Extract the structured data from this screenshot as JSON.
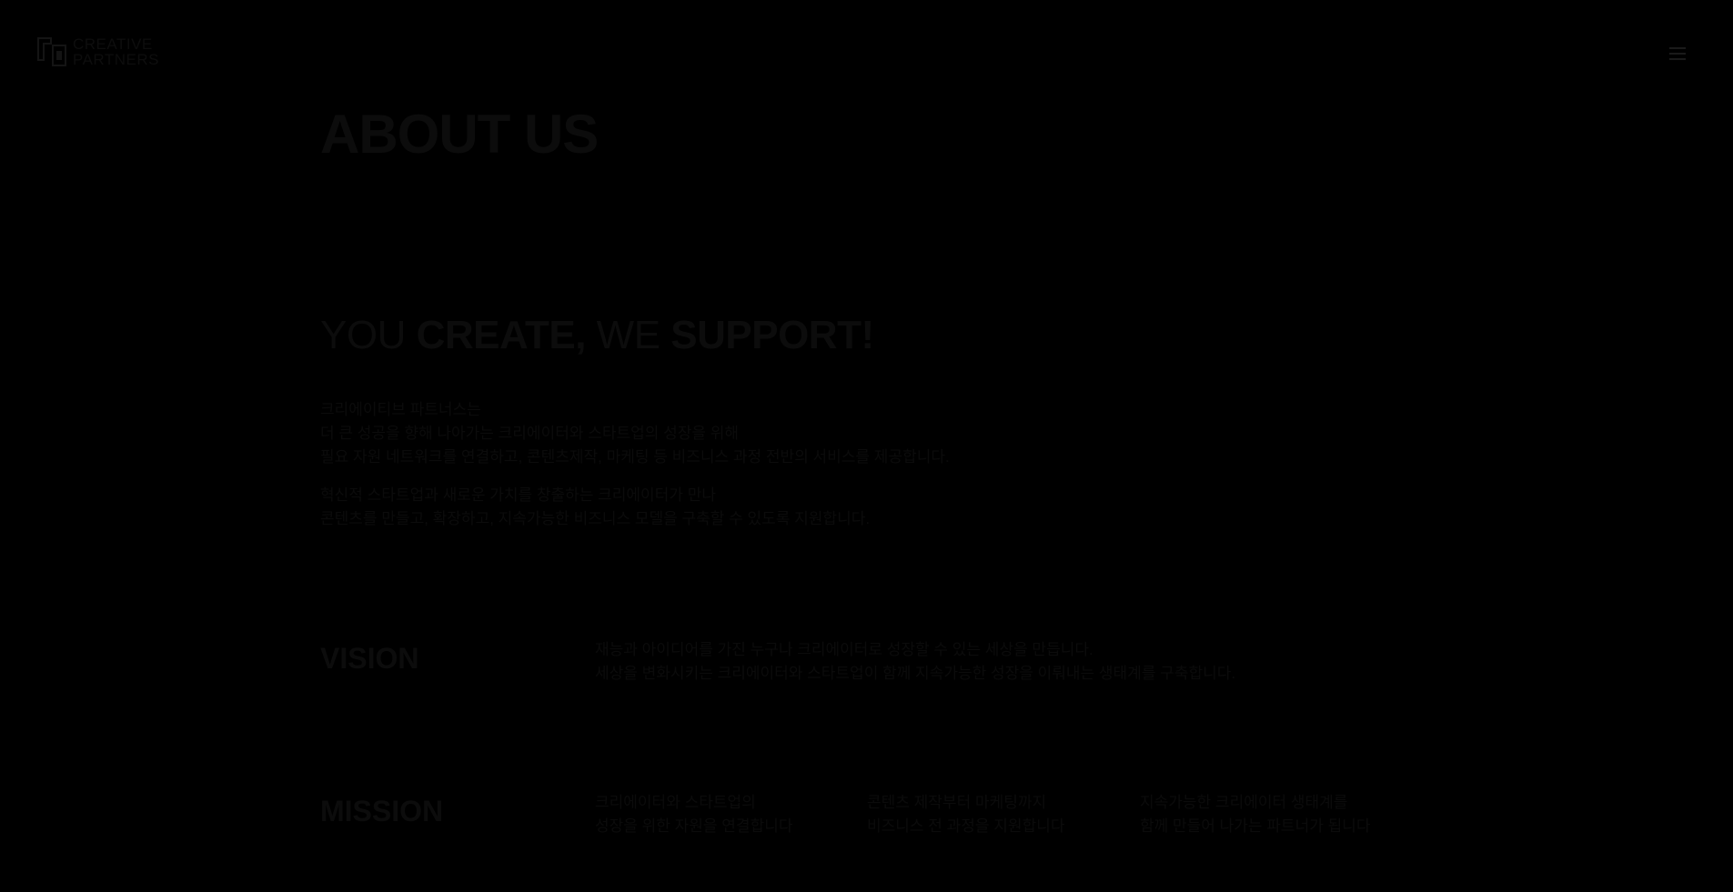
{
  "header": {
    "logo": {
      "line1": "CREATIVE",
      "line2": "PARTNERS"
    },
    "menu_icon": "hamburger-menu-icon"
  },
  "main": {
    "title": "ABOUT US",
    "slogan": {
      "part1": "YOU ",
      "part2": "CREATE,",
      "part3": " WE ",
      "part4": "SUPPORT!"
    },
    "intro": {
      "paragraph1": [
        "크리에이티브 파트너스는",
        "더 큰 성공을 향해 나아가는 크리에이터와 스타트업의 성장을 위해",
        "필요 자원 네트워크를 연결하고, 콘텐츠제작, 마케팅 등 비즈니스 과정 전반의 서비스를 제공합니다."
      ],
      "paragraph2": [
        "혁신적 스타트업과 새로운 가치를 창출하는 크리에이터가 만나",
        "콘텐츠를 만들고, 확장하고, 지속가능한 비즈니스 모델을 구축할 수 있도록 지원합니다."
      ]
    },
    "vision": {
      "label": "VISION",
      "lines": [
        "재능과 아이디어를 가진 누구나 크리에이터로 성장할 수 있는 세상을 만듭니다.",
        "세상을 변화시키는 크리에이터와 스타트업이 함께 지속가능한 성장을 이뤄내는 생태계를 구축합니다."
      ]
    },
    "mission": {
      "label": "MISSION",
      "items": [
        [
          "크리에이터와 스타트업의",
          "성장을 위한 자원을 연결합니다"
        ],
        [
          "콘텐츠 제작부터 마케팅까지",
          "비즈니스 전 과정을 지원합니다"
        ],
        [
          "지속가능한 크리에이터 생태계를",
          "함께 만들어 나가는 파트너가 됩니다"
        ]
      ]
    }
  }
}
